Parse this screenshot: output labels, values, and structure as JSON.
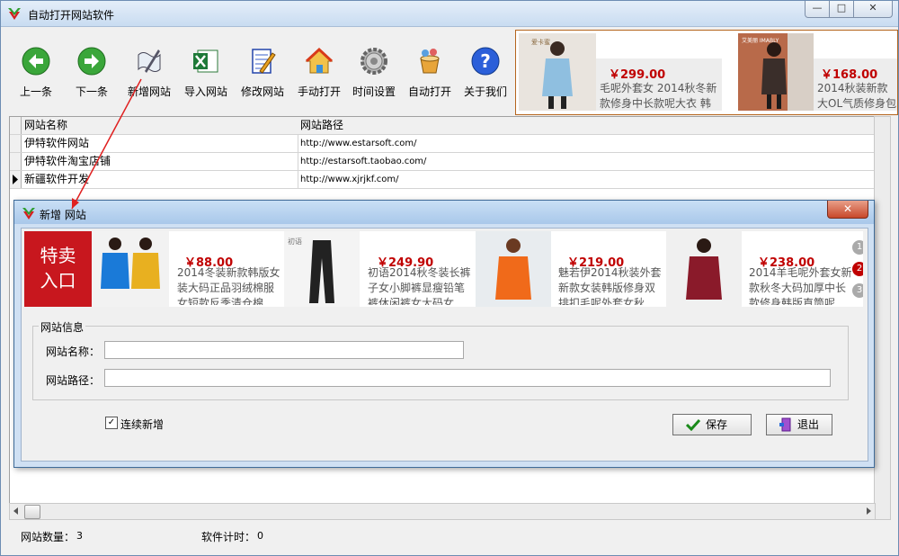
{
  "window": {
    "title": "自动打开网站软件",
    "minimize": "—",
    "maximize": "□",
    "close": "✕"
  },
  "toolbar": [
    {
      "label": "上一条",
      "icon": "back-arrow-icon"
    },
    {
      "label": "下一条",
      "icon": "forward-arrow-icon"
    },
    {
      "label": "新增网站",
      "icon": "quill-scroll-icon"
    },
    {
      "label": "导入网站",
      "icon": "excel-icon"
    },
    {
      "label": "修改网站",
      "icon": "notepad-pencil-icon"
    },
    {
      "label": "手动打开",
      "icon": "home-icon"
    },
    {
      "label": "时间设置",
      "icon": "gear-icon"
    },
    {
      "label": "自动打开",
      "icon": "bucket-icon"
    },
    {
      "label": "关于我们",
      "icon": "help-icon"
    }
  ],
  "top_ads": [
    {
      "brand": "爱卡蜜",
      "price": "￥299.00",
      "desc": "毛呢外套女 2014秋冬新款修身中长款呢大衣 韩"
    },
    {
      "brand": "艾美丽 IMABLY",
      "price": "￥168.00",
      "desc": "2014秋装新款大OL气质修身包臀"
    }
  ],
  "grid": {
    "headers": [
      "网站名称",
      "网站路径"
    ],
    "rows": [
      {
        "name": "伊特软件网站",
        "url": "http://www.estarsoft.com/"
      },
      {
        "name": "伊特软件淘宝店铺",
        "url": "http://estarsoft.taobao.com/"
      },
      {
        "name": "新疆软件开发",
        "url": "http://www.xjrjkf.com/",
        "current": true
      }
    ]
  },
  "status": {
    "count_label": "网站数量：",
    "count": "3",
    "timer_label": "软件计时：",
    "timer": "0"
  },
  "dialog": {
    "title": "新增 网站",
    "close": "✕",
    "promo": "特卖\n入口",
    "ads": [
      {
        "brand": "",
        "price": "￥88.00",
        "desc": "2014冬装新款韩版女装大码正品羽绒棉服女短款反季清仓棉"
      },
      {
        "brand": "初语",
        "price": "￥249.90",
        "desc": "初语2014秋冬装长裤子女小脚裤显瘦铅笔裤休闲裤女大码女"
      },
      {
        "brand": "",
        "price": "￥219.00",
        "desc": "魅若伊2014秋装外套新款女装韩版修身双排扣毛呢外套女秋"
      },
      {
        "brand": "",
        "price": "￥238.00",
        "desc": "2014羊毛呢外套女新款秋冬大码加厚中长款修身韩版直筒呢"
      }
    ],
    "pager": [
      "1",
      "2",
      "3"
    ],
    "group_title": "网站信息",
    "name_label": "网站名称：",
    "name_value": "",
    "path_label": "网站路径：",
    "path_value": "",
    "continuous_label": "连续新增",
    "continuous_checked": true,
    "save_label": "保存",
    "exit_label": "退出"
  },
  "colors": {
    "accent_red": "#c00000",
    "title_blue": "#c9dcf1",
    "promo_red": "#c8171e"
  }
}
